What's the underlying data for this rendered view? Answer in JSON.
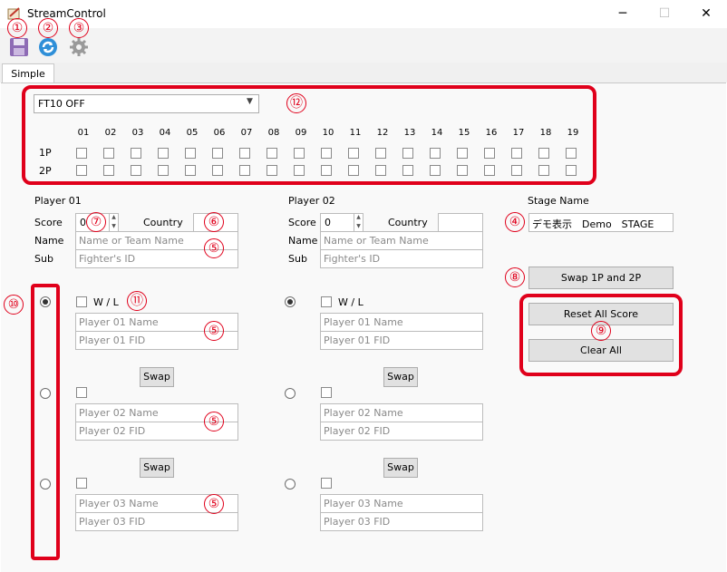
{
  "window": {
    "title": "StreamControl",
    "minimize": "─",
    "maximize": "☐",
    "close": "✕"
  },
  "tabs": [
    {
      "label": "Simple"
    }
  ],
  "ft": {
    "selected": "FT10 OFF",
    "columns": [
      "01",
      "02",
      "03",
      "04",
      "05",
      "06",
      "07",
      "08",
      "09",
      "10",
      "11",
      "12",
      "13",
      "14",
      "15",
      "16",
      "17",
      "18",
      "19"
    ],
    "row1": "1P",
    "row2": "2P"
  },
  "p1": {
    "header": "Player 01",
    "score_label": "Score",
    "score_value": "0",
    "country_label": "Country",
    "name_label": "Name",
    "name_placeholder": "Name or Team Name",
    "sub_label": "Sub",
    "sub_placeholder": "Fighter's ID"
  },
  "p2": {
    "header": "Player 02",
    "score_label": "Score",
    "score_value": "0",
    "country_label": "Country",
    "name_label": "Name",
    "name_placeholder": "Name or Team Name",
    "sub_label": "Sub",
    "sub_placeholder": "Fighter's ID"
  },
  "stage": {
    "label": "Stage Name",
    "value": "デモ表示　Demo　STAGE"
  },
  "buttons": {
    "swap_players": "Swap 1P and 2P",
    "reset_score": "Reset All Score",
    "clear_all": "Clear All",
    "swap": "Swap"
  },
  "wl": {
    "label": "W / L"
  },
  "slots_left": [
    {
      "name": "Player 01 Name",
      "fid": "Player 01 FID"
    },
    {
      "name": "Player 02 Name",
      "fid": "Player 02 FID"
    },
    {
      "name": "Player 03 Name",
      "fid": "Player 03 FID"
    }
  ],
  "slots_right": [
    {
      "name": "Player 01 Name",
      "fid": "Player 01 FID"
    },
    {
      "name": "Player 02 Name",
      "fid": "Player 02 FID"
    },
    {
      "name": "Player 03 Name",
      "fid": "Player 03 FID"
    }
  ],
  "badges": {
    "b1": "①",
    "b2": "②",
    "b3": "③",
    "b4": "④",
    "b5": "⑤",
    "b6": "⑥",
    "b7": "⑦",
    "b8": "⑧",
    "b9": "⑨",
    "b10": "⑩",
    "b11": "⑪",
    "b12": "⑫"
  },
  "colors": {
    "accent_red": "#e0001b"
  },
  "icons": {
    "save": "floppy-disk-icon",
    "refresh": "refresh-icon",
    "settings": "gear-icon",
    "app": "app-icon"
  }
}
